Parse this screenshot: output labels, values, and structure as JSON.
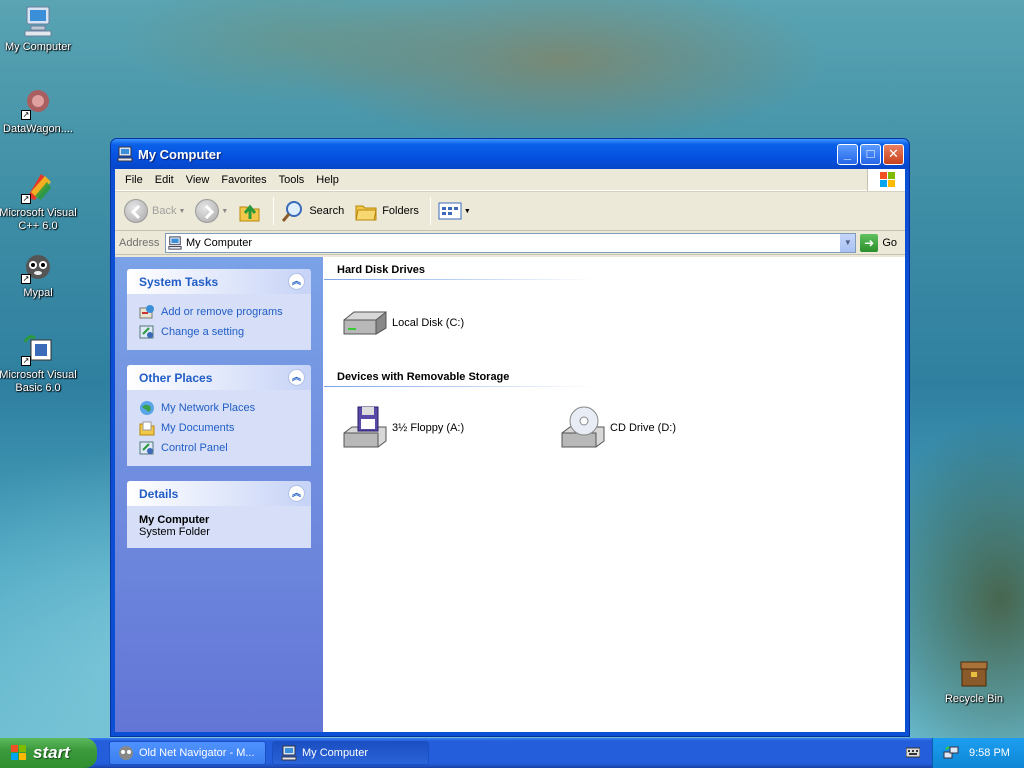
{
  "desktop": {
    "icons": [
      {
        "label": "My Computer"
      },
      {
        "label": "DataWagon...."
      },
      {
        "label": "Microsoft Visual C++ 6.0"
      },
      {
        "label": "Mypal"
      },
      {
        "label": "Microsoft Visual Basic 6.0"
      },
      {
        "label": "Recycle Bin"
      }
    ]
  },
  "window": {
    "title": "My Computer",
    "menu": [
      "File",
      "Edit",
      "View",
      "Favorites",
      "Tools",
      "Help"
    ],
    "toolbar": {
      "back": "Back",
      "search": "Search",
      "folders": "Folders"
    },
    "address": {
      "label": "Address",
      "value": "My Computer",
      "go": "Go"
    },
    "system_tasks": {
      "title": "System Tasks",
      "items": [
        "Add or remove programs",
        "Change a setting"
      ]
    },
    "other_places": {
      "title": "Other Places",
      "items": [
        "My Network Places",
        "My Documents",
        "Control Panel"
      ]
    },
    "details": {
      "title": "Details",
      "name": "My Computer",
      "type": "System Folder"
    },
    "groups": [
      {
        "title": "Hard Disk Drives",
        "items": [
          "Local Disk (C:)"
        ]
      },
      {
        "title": "Devices with Removable Storage",
        "items": [
          "3½ Floppy (A:)",
          "CD Drive (D:)"
        ]
      }
    ]
  },
  "taskbar": {
    "start": "start",
    "buttons": [
      "Old Net Navigator - M...",
      "My Computer"
    ],
    "clock": "9:58 PM"
  }
}
